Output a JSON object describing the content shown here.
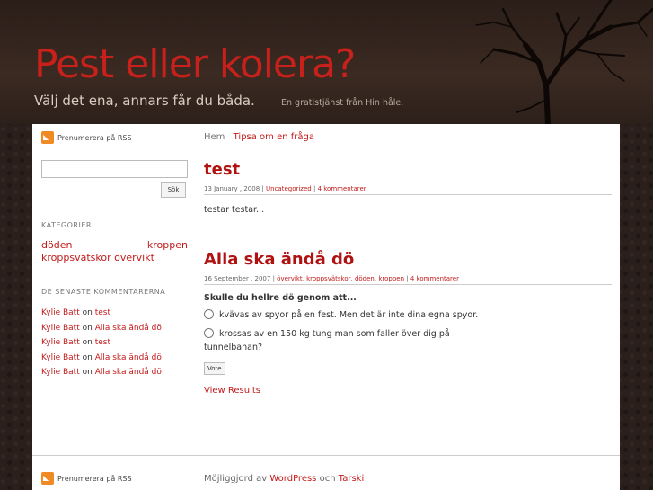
{
  "site": {
    "title": "Pest eller kolera?",
    "subtitle": "Välj det ena, annars får du båda.",
    "tagline": "En gratistjänst från Hin håle."
  },
  "sidebar": {
    "rss_label": "Prenumerera på RSS",
    "search_button": "Sök",
    "categories_heading": "KATEGORIER",
    "categories": [
      "döden",
      "kroppen",
      "kroppsvätskor",
      "övervikt"
    ],
    "recent_comments_heading": "DE SENASTE KOMMENTARERNA",
    "recent_comments": [
      {
        "author": "Kylie Batt",
        "on": "on",
        "post": "test"
      },
      {
        "author": "Kylie Batt",
        "on": "on",
        "post": "Alla ska ändå dö"
      },
      {
        "author": "Kylie Batt",
        "on": "on",
        "post": "test"
      },
      {
        "author": "Kylie Batt",
        "on": "on",
        "post": "Alla ska ändå dö"
      },
      {
        "author": "Kylie Batt",
        "on": "on",
        "post": "Alla ska ändå dö"
      }
    ]
  },
  "nav": {
    "home": "Hem",
    "tip": "Tipsa om en fråga"
  },
  "posts": [
    {
      "title": "test",
      "date": "13 January , 2008",
      "sep": "|",
      "category": "Uncategorized",
      "comments": "4 kommentarer",
      "body": "testar testar..."
    },
    {
      "title": "Alla ska ändå dö",
      "date": "16 September , 2007",
      "sep": "|",
      "categories": [
        "övervikt",
        "kroppsvätskor",
        "döden",
        "kroppen"
      ],
      "comments": "4 kommentarer",
      "poll_question": "Skulle du hellre dö genom att...",
      "options": [
        "kvävas av spyor på en fest. Men det är inte dina egna spyor.",
        "krossas av en 150 kg tung man som faller över dig på",
        "tunnelbanan?"
      ],
      "vote_label": "Vote",
      "view_results": "View Results"
    }
  ],
  "footer": {
    "rss_label": "Prenumerera på RSS",
    "powered_prefix": "Möjliggjord av",
    "wordpress": "WordPress",
    "and": "och",
    "tarski": "Tarski"
  }
}
